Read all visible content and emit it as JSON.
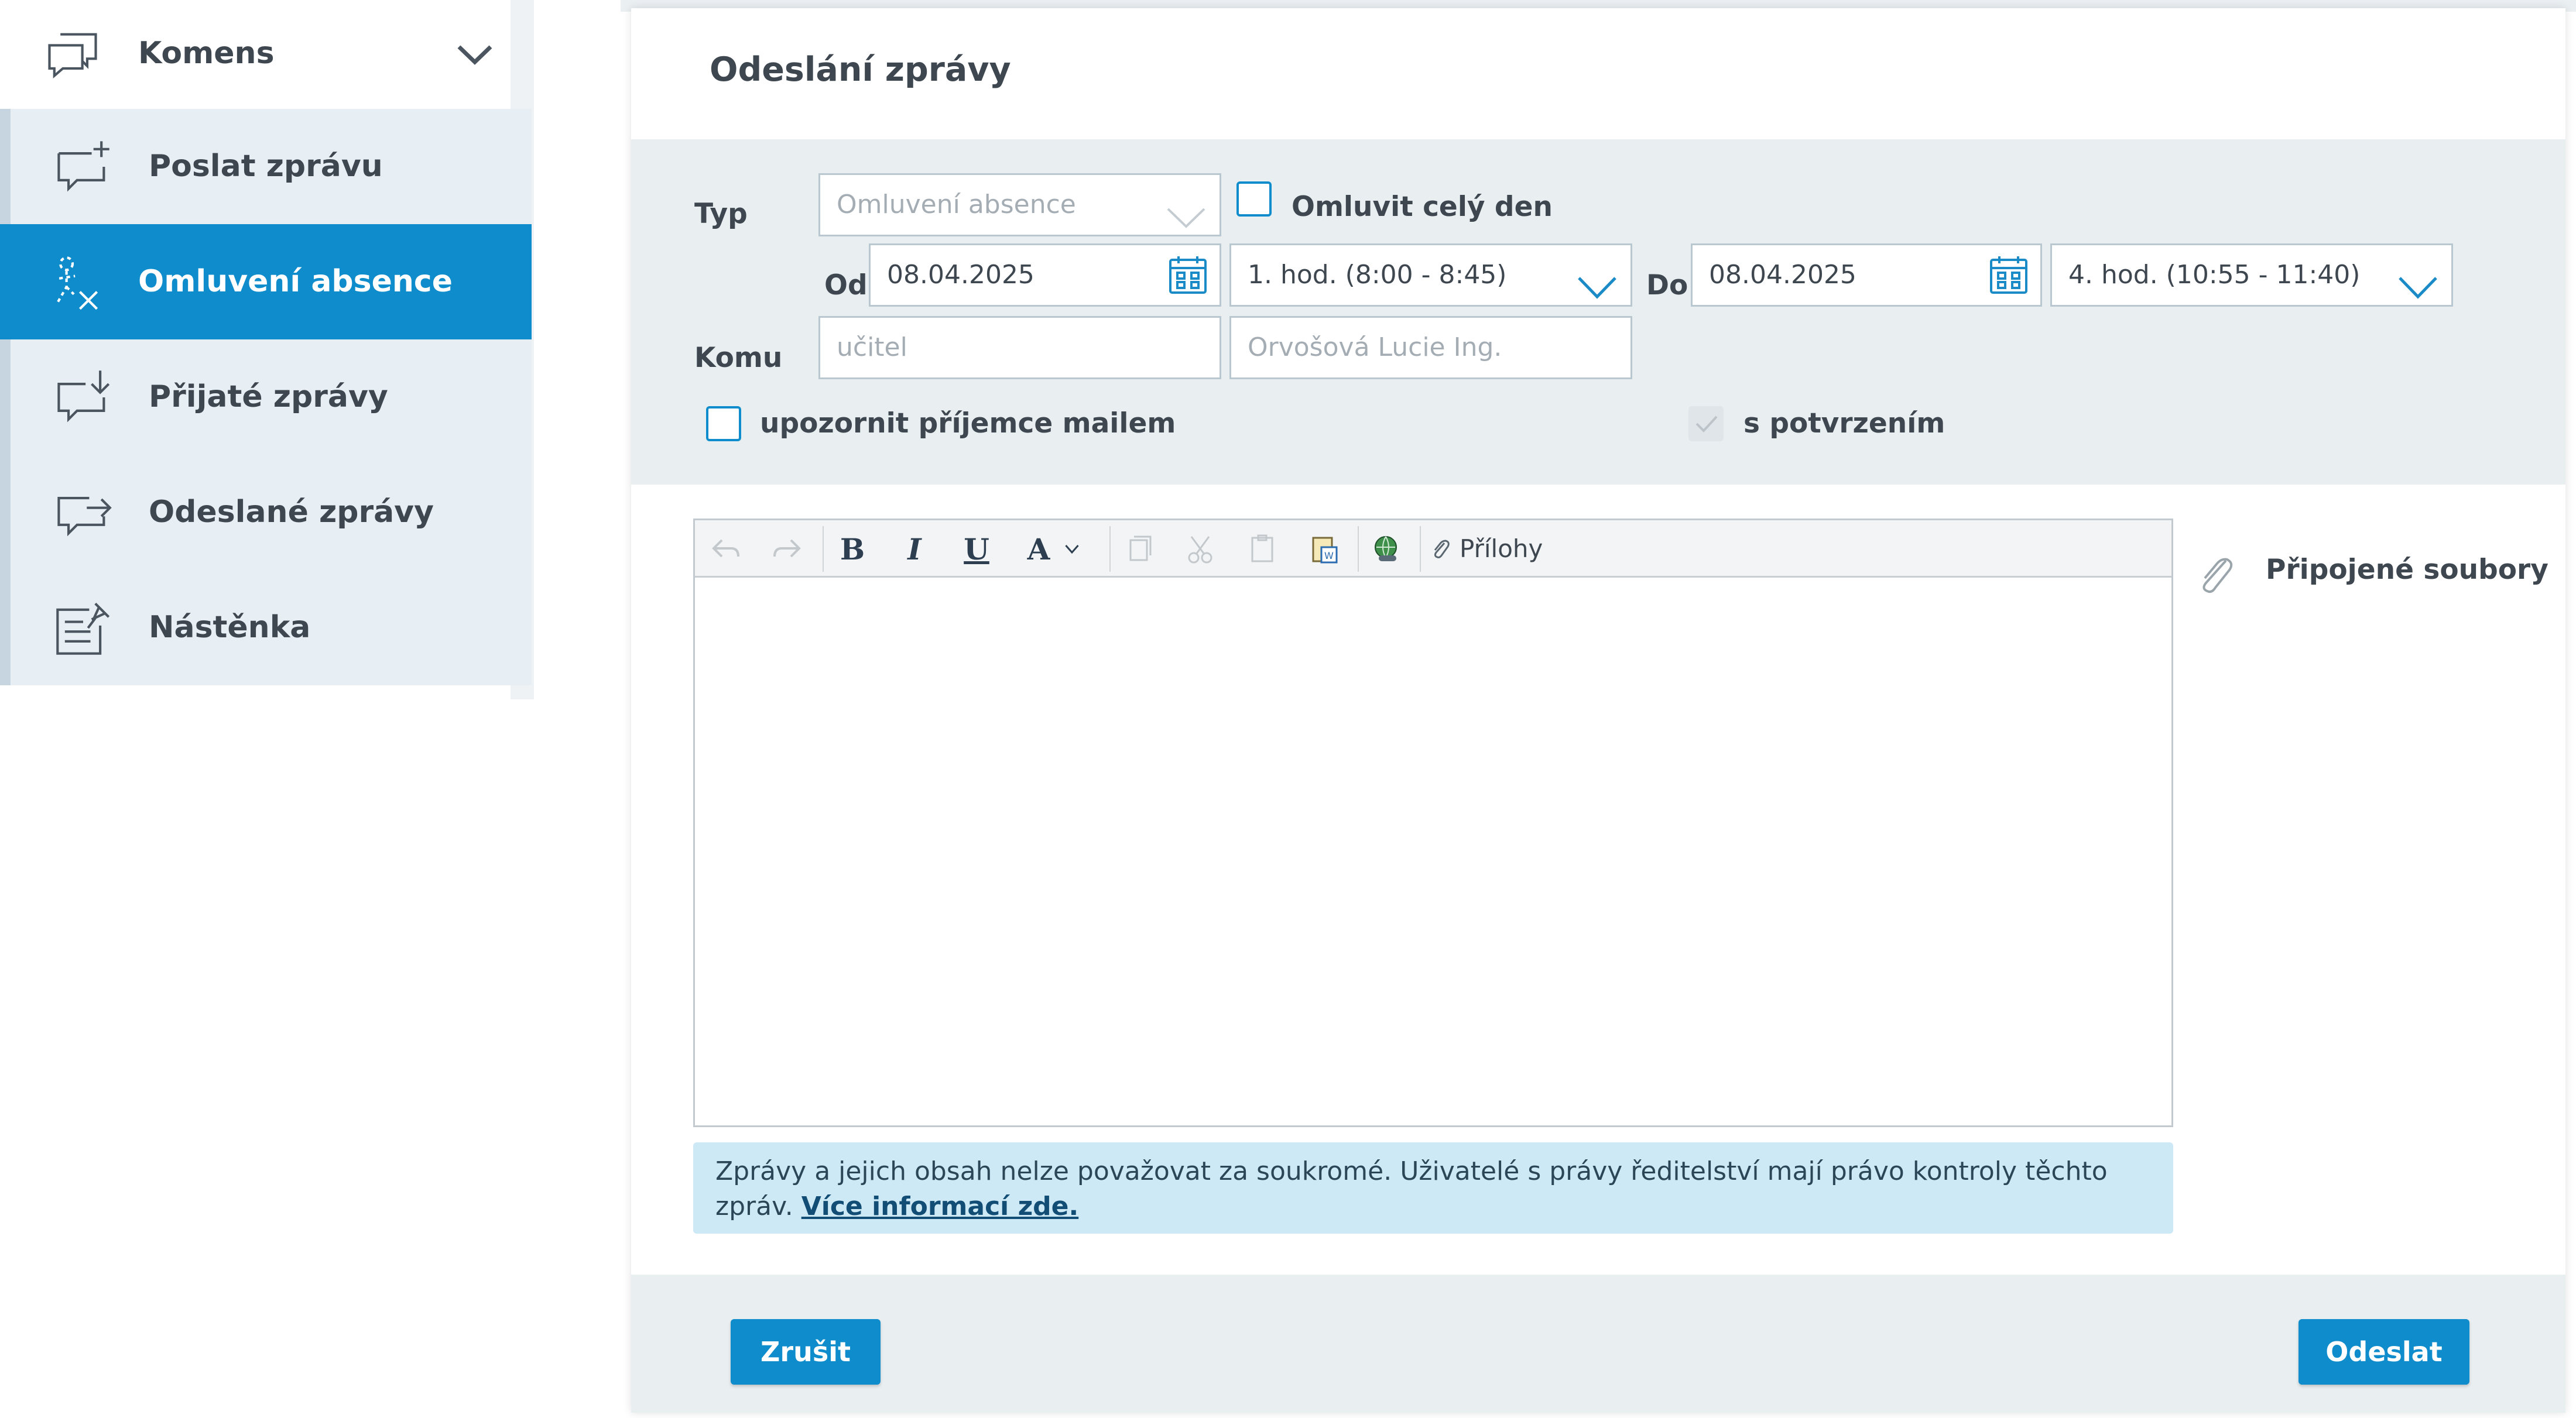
{
  "sidebar": {
    "header": {
      "label": "Komens",
      "icon": "chat-bubbles-icon"
    },
    "items": [
      {
        "label": "Poslat zprávu",
        "icon": "message-plus-icon",
        "active": false
      },
      {
        "label": "Omluvení absence",
        "icon": "absence-excuse-icon",
        "active": true
      },
      {
        "label": "Přijaté zprávy",
        "icon": "message-inbox-icon",
        "active": false
      },
      {
        "label": "Odeslané zprávy",
        "icon": "message-sent-icon",
        "active": false
      },
      {
        "label": "Nástěnka",
        "icon": "noticeboard-icon",
        "active": false
      }
    ]
  },
  "panel": {
    "title": "Odeslání zprávy",
    "form": {
      "type_label": "Typ",
      "type_value": "Omluvení absence",
      "whole_day_label": "Omluvit celý den",
      "from_label": "Od",
      "from_date": "08.04.2025",
      "from_lesson": "1. hod. (8:00 - 8:45)",
      "to_label": "Do",
      "to_date": "08.04.2025",
      "to_lesson": "4. hod. (10:55 - 11:40)",
      "to_recipient_label": "Komu",
      "recipient_type_placeholder": "učitel",
      "recipient_name_placeholder": "Orvošová Lucie Ing.",
      "notify_email_label": "upozornit příjemce mailem",
      "confirm_label": "s potvrzením"
    },
    "editor": {
      "toolbar": {
        "bold": "B",
        "italic": "I",
        "underline": "U",
        "font_color": "A",
        "attachments_label": "Přílohy"
      }
    },
    "attached_files_label": "Připojené soubory",
    "notice": {
      "text": "Zprávy a jejich obsah nelze považovat za soukromé. Uživatelé s právy ředitelství mají právo kontroly těchto zpráv. ",
      "link": "Více informací zde."
    },
    "buttons": {
      "cancel": "Zrušit",
      "send": "Odeslat"
    }
  },
  "colors": {
    "accent": "#0f8ccc",
    "sidebar_bg": "#e8eff4",
    "form_bg": "#e9eef1",
    "notice_bg": "#cde9f6"
  }
}
